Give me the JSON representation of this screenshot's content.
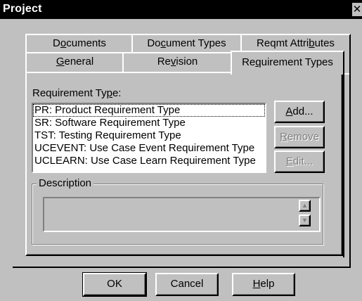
{
  "window": {
    "title": "Project",
    "close_glyph": "✕"
  },
  "tabs": {
    "back_row": [
      {
        "pre": "D",
        "ul": "o",
        "post": "cuments"
      },
      {
        "pre": "Do",
        "ul": "c",
        "post": "ument Types"
      },
      {
        "pre": "Reqmt Attri",
        "ul": "b",
        "post": "utes"
      }
    ],
    "front_row": [
      {
        "pre": "",
        "ul": "G",
        "post": "eneral"
      },
      {
        "pre": "Re",
        "ul": "v",
        "post": "ision"
      },
      {
        "pre": "Re",
        "ul": "q",
        "post": "uirement Types"
      }
    ],
    "active": "Requirement Types"
  },
  "requirement_type": {
    "label_pre": "Requirement Ty",
    "label_ul": "p",
    "label_post": "e:",
    "items": [
      "PR: Product Requirement Type",
      "SR: Software Requirement Type",
      "TST: Testing Requirement Type",
      "UCEVENT: Use Case Event Requirement Type",
      "UCLEARN: Use Case Learn Requirement Type"
    ],
    "selected_index": 0
  },
  "side_buttons": {
    "add": {
      "ul": "A",
      "post": "dd..."
    },
    "remove": {
      "ul": "R",
      "post": "emove"
    },
    "edit": {
      "ul": "E",
      "post": "dit..."
    }
  },
  "description": {
    "label": "Description",
    "value": ""
  },
  "footer_buttons": {
    "ok": "OK",
    "cancel": "Cancel",
    "help_ul": "H",
    "help_post": "elp"
  },
  "colors": {
    "face": "#c0c0c0",
    "titlebar": "#000000",
    "highlight": "#ffffff",
    "shadow": "#808080"
  }
}
